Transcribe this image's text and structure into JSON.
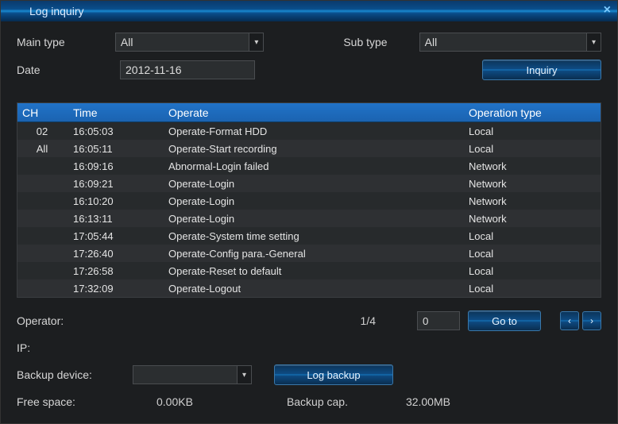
{
  "window": {
    "title": "Log inquiry"
  },
  "filters": {
    "mainTypeLabel": "Main type",
    "mainTypeValue": "All",
    "subTypeLabel": "Sub type",
    "subTypeValue": "All",
    "dateLabel": "Date",
    "dateValue": "2012-11-16",
    "inquiryLabel": "Inquiry"
  },
  "headers": {
    "ch": "CH",
    "time": "Time",
    "operate": "Operate",
    "opType": "Operation type"
  },
  "rows": [
    {
      "ch": "02",
      "time": "16:05:03",
      "op": "Operate-Format HDD",
      "type": "Local"
    },
    {
      "ch": "All",
      "time": "16:05:11",
      "op": "Operate-Start recording",
      "type": "Local"
    },
    {
      "ch": "",
      "time": "16:09:16",
      "op": "Abnormal-Login failed",
      "type": "Network"
    },
    {
      "ch": "",
      "time": "16:09:21",
      "op": "Operate-Login",
      "type": "Network"
    },
    {
      "ch": "",
      "time": "16:10:20",
      "op": "Operate-Login",
      "type": "Network"
    },
    {
      "ch": "",
      "time": "16:13:11",
      "op": "Operate-Login",
      "type": "Network"
    },
    {
      "ch": "",
      "time": "17:05:44",
      "op": "Operate-System time setting",
      "type": "Local"
    },
    {
      "ch": "",
      "time": "17:26:40",
      "op": "Operate-Config para.-General",
      "type": "Local"
    },
    {
      "ch": "",
      "time": "17:26:58",
      "op": "Operate-Reset to default",
      "type": "Local"
    },
    {
      "ch": "",
      "time": "17:32:09",
      "op": "Operate-Logout",
      "type": "Local"
    }
  ],
  "footer": {
    "operatorLabel": "Operator:",
    "operatorValue": "",
    "pageCounter": "1/4",
    "pageInput": "0",
    "gotoLabel": "Go to",
    "ipLabel": "IP:",
    "ipValue": "",
    "backupDeviceLabel": "Backup device:",
    "backupDeviceValue": "",
    "logBackupLabel": "Log backup",
    "freeSpaceLabel": "Free space:",
    "freeSpaceValue": "0.00KB",
    "backupCapLabel": "Backup cap.",
    "backupCapValue": "32.00MB"
  }
}
